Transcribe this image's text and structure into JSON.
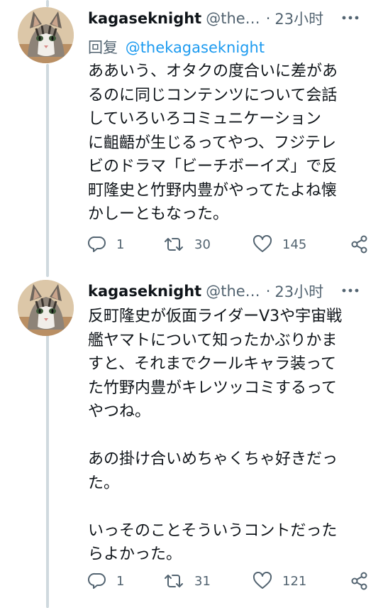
{
  "tweets": [
    {
      "display_name": "kagaseknight",
      "handle": "@the…",
      "separator": "·",
      "time": "23小时",
      "reply_prefix": "回复",
      "reply_to": "@thekagaseknight",
      "lines": [
        "ああいう、オタクの度合いに差があ",
        "るのに同じコンテンツについて会話",
        "していろいろコミュニケーション",
        "に齟齬が生じるってやつ、フジテレ",
        "ビのドラマ「ビーチボーイズ」で反",
        "町隆史と竹野内豊がやってたよね懐",
        "かしーともなった。"
      ],
      "replies": "1",
      "retweets": "30",
      "likes": "145"
    },
    {
      "display_name": "kagaseknight",
      "handle": "@the…",
      "separator": "·",
      "time": "23小时",
      "lines": [
        "反町隆史が仮面ライダーV3や宇宙戦",
        "艦ヤマトについて知ったかぶりかま",
        "すと、それまでクールキャラ装って",
        "た竹野内豊がキレツッコミするって",
        "やつね。",
        "",
        "あの掛け合いめちゃくちゃ好きだっ",
        "た。",
        "",
        "いっそのことそういうコントだった",
        "らよかった。"
      ],
      "replies": "1",
      "retweets": "31",
      "likes": "121"
    }
  ],
  "icons": {
    "more": "more-dots-icon",
    "reply": "reply-icon",
    "retweet": "retweet-icon",
    "like": "heart-icon",
    "share": "share-icon"
  },
  "colors": {
    "text": "#0f1419",
    "secondary": "#536471",
    "link": "#1d9bf0",
    "thread_line": "#cfd9de"
  }
}
